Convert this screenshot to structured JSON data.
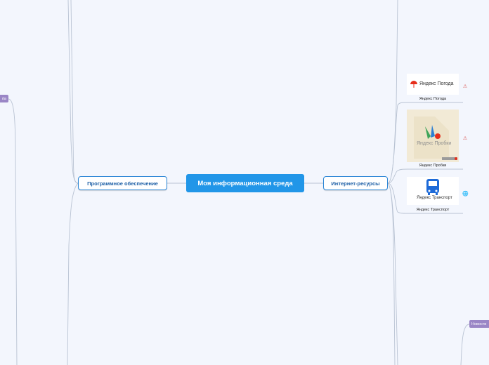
{
  "central": {
    "label": "Моя информационная среда"
  },
  "branches": {
    "software": {
      "label": "Программное обеспечение"
    },
    "internet": {
      "label": "Интернет-ресурсы"
    }
  },
  "tags": {
    "left_cut": "ıta",
    "news": "Новости"
  },
  "resources": [
    {
      "label": "Яндекс Погода",
      "logo_text": "Яндекс Погода",
      "icon": "umbrella-icon",
      "badge": "warning-icon"
    },
    {
      "label": "Яндекс Пробки",
      "logo_text": "Яндекс Пробки",
      "icon": "map-pin-icon",
      "badge": "warning-icon"
    },
    {
      "label": "Яндекс Транспорт",
      "logo_text": "Яндекс Транспорт",
      "icon": "bus-icon",
      "badge": "globe-icon"
    }
  ],
  "colors": {
    "background": "#f3f6fd",
    "central_fill": "#2196e8",
    "branch_border": "#2b86d6",
    "branch_text": "#1d5fa6",
    "tag_fill": "#9a86c6",
    "connector": "#b9c3d3",
    "yandex_red": "#e62e1b"
  }
}
